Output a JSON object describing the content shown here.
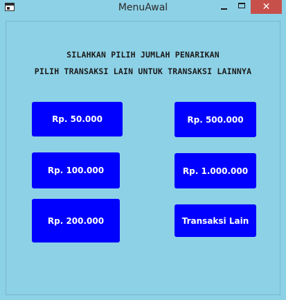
{
  "window": {
    "title": "MenuAwal",
    "close_glyph": "✕"
  },
  "instructions": {
    "line1": "SILAHKAN PILIH JUMLAH PENARIKAN",
    "line2": "PILIH TRANSAKSI LAIN UNTUK TRANSAKSI LAINNYA"
  },
  "buttons": {
    "amount_50k": "Rp. 50.000",
    "amount_100k": "Rp. 100.000",
    "amount_200k": "Rp. 200.000",
    "amount_500k": "Rp. 500.000",
    "amount_1m": "Rp. 1.000.000",
    "other": "Transaksi Lain"
  },
  "colors": {
    "background": "#8dd1e6",
    "button": "#0000ff",
    "button_text": "#ffffff",
    "close_button": "#c7504a"
  },
  "icons": {
    "app": "window-app-icon",
    "minimize": "minimize-icon",
    "maximize": "maximize-icon",
    "close": "close-icon"
  }
}
